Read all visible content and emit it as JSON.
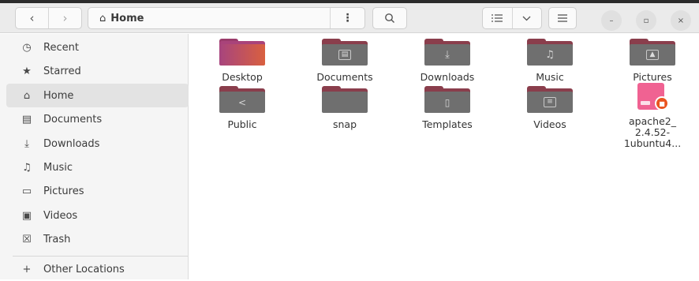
{
  "header": {
    "back_icon": "chevron-left",
    "forward_icon": "chevron-right",
    "path": {
      "home_icon": "home",
      "label": "Home"
    },
    "path_menu_icon": "vertical-dots",
    "search_icon": "magnifier",
    "view_list_icon": "list-view",
    "view_options_icon": "chevron-down",
    "main_menu_icon": "hamburger",
    "window_controls": {
      "minimize": "–",
      "maximize": "▫",
      "close": "×"
    }
  },
  "sidebar": {
    "items": [
      {
        "label": "Recent",
        "icon": "clock-icon",
        "glyph": "🕓",
        "active": false
      },
      {
        "label": "Starred",
        "icon": "star-icon",
        "glyph": "★",
        "active": false
      },
      {
        "label": "Home",
        "icon": "home-icon",
        "glyph": "⌂",
        "active": true
      },
      {
        "label": "Documents",
        "icon": "document-icon",
        "glyph": "▤",
        "active": false
      },
      {
        "label": "Downloads",
        "icon": "download-icon",
        "glyph": "⤓",
        "active": false
      },
      {
        "label": "Music",
        "icon": "music-icon",
        "glyph": "♫",
        "active": false
      },
      {
        "label": "Pictures",
        "icon": "picture-icon",
        "glyph": "▭",
        "active": false
      },
      {
        "label": "Videos",
        "icon": "video-icon",
        "glyph": "▣",
        "active": false
      },
      {
        "label": "Trash",
        "icon": "trash-icon",
        "glyph": "🗑",
        "active": false
      }
    ],
    "other": {
      "label": "Other Locations",
      "icon": "plus-icon",
      "glyph": "+"
    }
  },
  "files": [
    {
      "label": "Desktop",
      "type": "folder",
      "emblem": ""
    },
    {
      "label": "Documents",
      "type": "folder",
      "emblem": "▤"
    },
    {
      "label": "Downloads",
      "type": "folder",
      "emblem": "⤓"
    },
    {
      "label": "Music",
      "type": "folder",
      "emblem": "♫"
    },
    {
      "label": "Pictures",
      "type": "folder",
      "emblem": "▭"
    },
    {
      "label": "Public",
      "type": "folder",
      "emblem": "<"
    },
    {
      "label": "snap",
      "type": "folder",
      "emblem": ""
    },
    {
      "label": "Templates",
      "type": "folder",
      "emblem": "▯"
    },
    {
      "label": "Videos",
      "type": "folder",
      "emblem": "▣"
    },
    {
      "label": "apache2_\n2.4.52-\n1ubuntu4...",
      "type": "deb-package",
      "emblem": ""
    }
  ],
  "colors": {
    "folder_tab": "#8a3e4c",
    "folder_front": "#6f6f6f",
    "desktop_gradient_start": "#a7447e",
    "desktop_gradient_end": "#d9603f",
    "accent_orange": "#e95420",
    "deb_pink": "#f06292"
  }
}
